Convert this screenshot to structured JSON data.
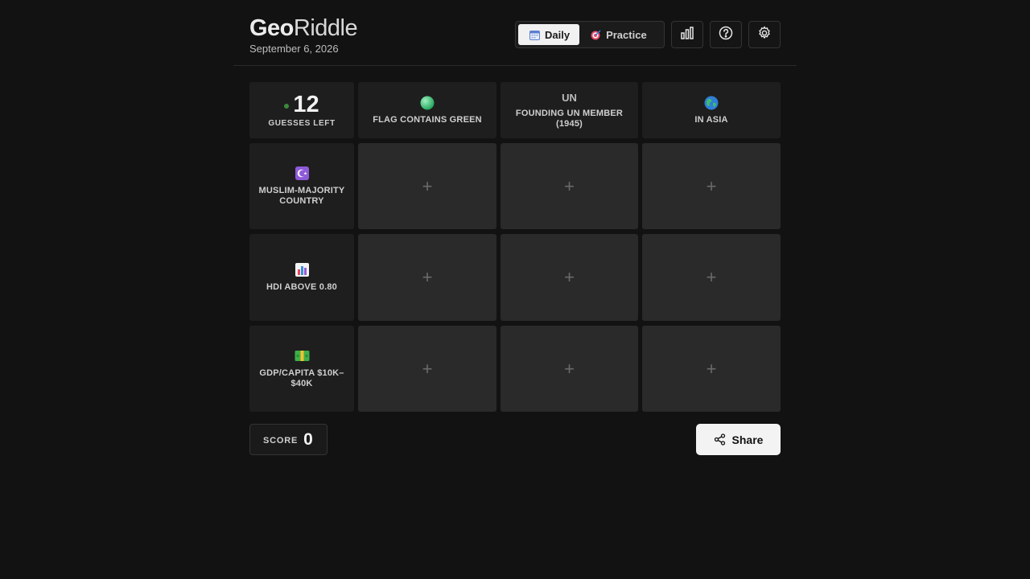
{
  "app": {
    "title_bold": "Geo",
    "title_light": "Riddle",
    "date": "September 6, 2026"
  },
  "modes": {
    "daily": {
      "label": "Daily",
      "icon": "calendar-icon",
      "active": true
    },
    "practice": {
      "label": "Practice",
      "icon": "target-icon",
      "active": false
    }
  },
  "toolbar": {
    "stats_icon": "bar-chart-icon",
    "help_icon": "question-circle-icon",
    "settings_icon": "gear-icon"
  },
  "counter": {
    "value": "12",
    "label": "GUESSES LEFT"
  },
  "columns": [
    {
      "label": "FLAG CONTAINS GREEN",
      "icon": "green-circle-icon"
    },
    {
      "label": "FOUNDING UN MEMBER (1945)",
      "icon_text": "UN"
    },
    {
      "label": "IN ASIA",
      "icon": "globe-icon"
    }
  ],
  "rows": [
    {
      "label": "MUSLIM-MAJORITY COUNTRY",
      "icon": "star-crescent-icon"
    },
    {
      "label": "HDI ABOVE 0.80",
      "icon": "bar-chart-emoji-icon"
    },
    {
      "label": "GDP/CAPITA $10K–$40K",
      "icon": "money-icon"
    }
  ],
  "cell_placeholder": "+",
  "score": {
    "label": "SCORE",
    "value": "0"
  },
  "share": {
    "label": "Share",
    "icon": "share-icon"
  },
  "colors": {
    "background": "#121212",
    "header_cell": "#1e1e1e",
    "guess_cell": "#2a2a2a",
    "accent_green": "#3b8a3b",
    "button_light": "#f3f3f3"
  }
}
